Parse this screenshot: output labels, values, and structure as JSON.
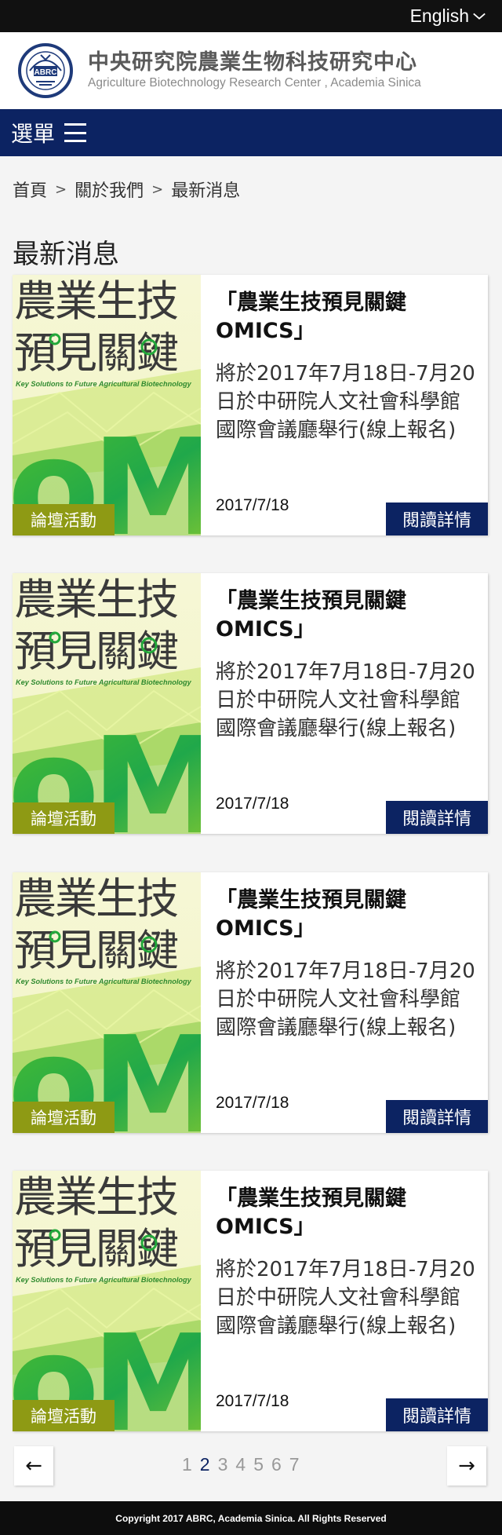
{
  "topbar": {
    "language_label": "English"
  },
  "header": {
    "org_name_zh": "中央研究院農業生物科技研究中心",
    "org_name_en": "Agriculture Biotechnology Research Center , Academia Sinica",
    "seal_text": "ABRC"
  },
  "menu": {
    "label": "選單"
  },
  "breadcrumb": {
    "items": [
      "首頁",
      "關於我們",
      "最新消息"
    ],
    "separator": ">"
  },
  "page_title": "最新消息",
  "news": [
    {
      "category": "論壇活動",
      "title": "「農業生技預見關鍵OMICS」",
      "description": "將於2017年7月18日-7月20日於中研院人文社會科學館國際會議廳舉行(線上報名)",
      "date": "2017/7/18",
      "more_label": "閱讀詳情"
    },
    {
      "category": "論壇活動",
      "title": "「農業生技預見關鍵OMICS」",
      "description": "將於2017年7月18日-7月20日於中研院人文社會科學館國際會議廳舉行(線上報名)",
      "date": "2017/7/18",
      "more_label": "閱讀詳情"
    },
    {
      "category": "論壇活動",
      "title": "「農業生技預見關鍵OMICS」",
      "description": "將於2017年7月18日-7月20日於中研院人文社會科學館國際會議廳舉行(線上報名)",
      "date": "2017/7/18",
      "more_label": "閱讀詳情"
    },
    {
      "category": "論壇活動",
      "title": "「農業生技預見關鍵OMICS」",
      "description": "將於2017年7月18日-7月20日於中研院人文社會科學館國際會議廳舉行(線上報名)",
      "date": "2017/7/18",
      "more_label": "閱讀詳情"
    }
  ],
  "thumbnail": {
    "line1": "農業生技",
    "line2": "預見關鍵",
    "subtitle": "Key Solutions to Future Agricultural Biotechnology",
    "big_text": "oMi"
  },
  "pagination": {
    "prev": "←",
    "next": "→",
    "pages": [
      "1",
      "2",
      "3",
      "4",
      "5",
      "6",
      "7"
    ],
    "current": "2"
  },
  "footer": {
    "copyright": "Copyright 2017 ABRC, Academia Sinica. All Rights Reserved"
  },
  "colors": {
    "navy": "#0c2362",
    "olive": "#8e9a14",
    "green": "#22a83a"
  }
}
